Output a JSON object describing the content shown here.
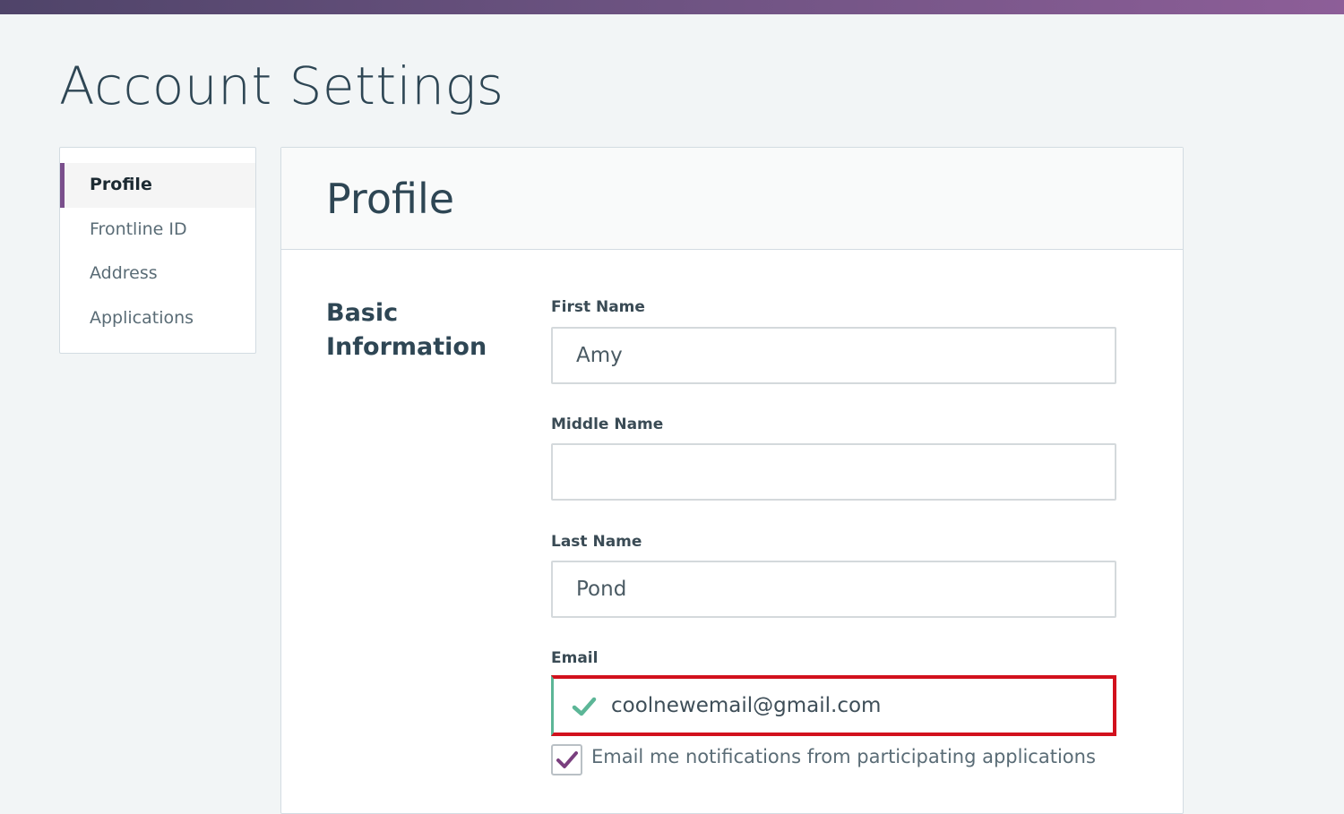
{
  "page": {
    "title": "Account Settings"
  },
  "colors": {
    "accent": "#7a4f8c",
    "valid": "#5cb697",
    "highlight": "#d2111d",
    "heading": "#2e4654"
  },
  "sidebar": {
    "items": [
      {
        "label": "Profile",
        "active": true
      },
      {
        "label": "Frontline ID",
        "active": false
      },
      {
        "label": "Address",
        "active": false
      },
      {
        "label": "Applications",
        "active": false
      }
    ]
  },
  "panel": {
    "title": "Profile",
    "section_title": "Basic Information"
  },
  "form": {
    "first_name": {
      "label": "First Name",
      "value": "Amy"
    },
    "middle_name": {
      "label": "Middle Name",
      "value": ""
    },
    "last_name": {
      "label": "Last Name",
      "value": "Pond"
    },
    "email": {
      "label": "Email",
      "value": "coolnewemail@gmail.com",
      "status_icon": "checkmark-icon"
    },
    "notifications": {
      "label": "Email me notifications from participating applications",
      "checked": true
    }
  }
}
